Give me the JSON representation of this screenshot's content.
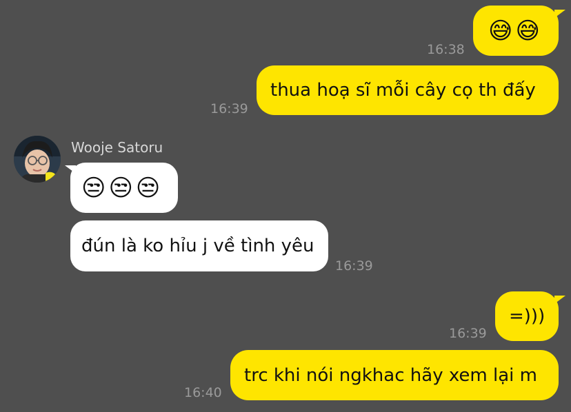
{
  "chat": {
    "partner": {
      "name": "Wooje Satoru",
      "avatar_icon": "profile-photo"
    },
    "messages": [
      {
        "from": "me",
        "text": "😅😅",
        "time": "16:38"
      },
      {
        "from": "me",
        "text": "thua hoạ sĩ mỗi cây cọ th đấy",
        "time": "16:39"
      },
      {
        "from": "Wooje Satoru",
        "text": "😒😒😒",
        "time": ""
      },
      {
        "from": "Wooje Satoru",
        "text": "đún là ko hỉu j về tình yêu",
        "time": "16:39"
      },
      {
        "from": "me",
        "text": "=)))",
        "time": "16:39"
      },
      {
        "from": "me",
        "text": "trc khi nói ngkhac hãy xem lại m",
        "time": "16:40"
      }
    ]
  },
  "colors": {
    "background": "#4f4f4f",
    "my_bubble": "#fee500",
    "their_bubble": "#ffffff",
    "timestamp": "#9a9a9a"
  }
}
